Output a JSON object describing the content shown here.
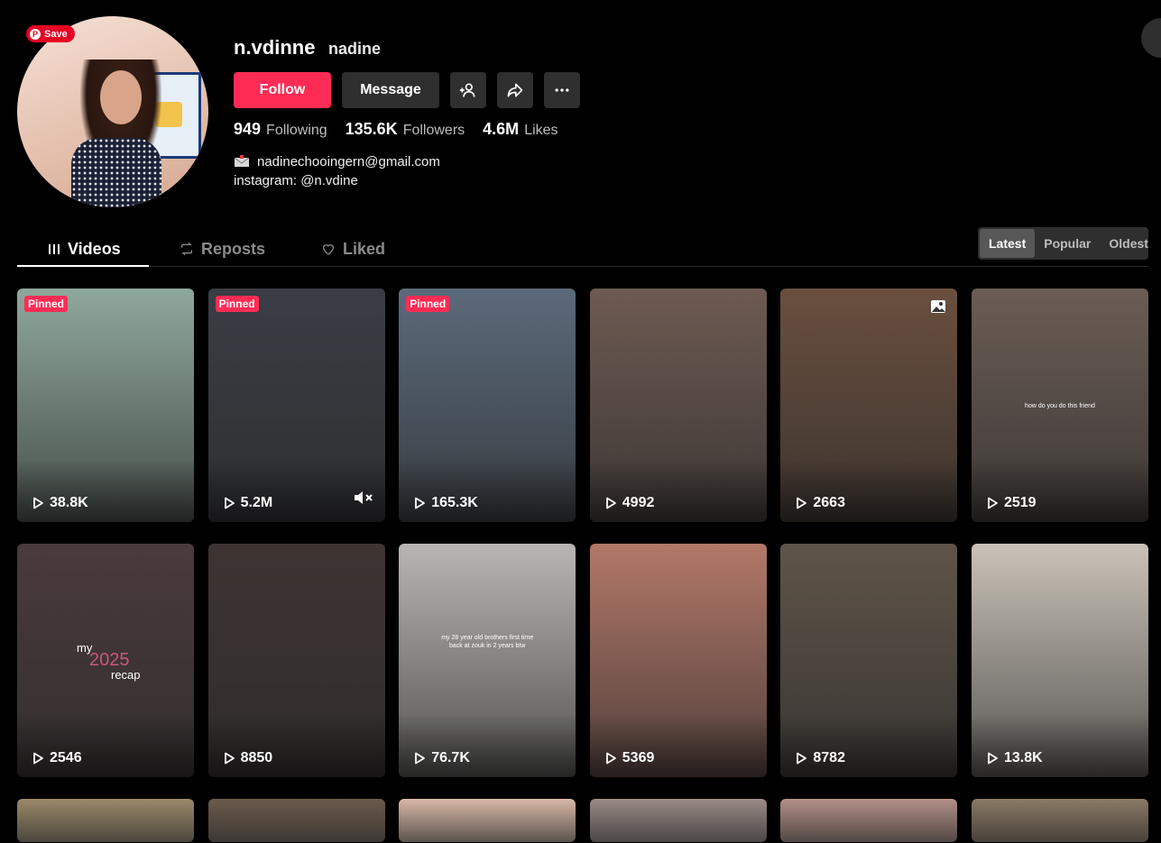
{
  "profile": {
    "save_label": "Save",
    "username": "n.vdinne",
    "nickname": "nadine",
    "follow_label": "Follow",
    "message_label": "Message",
    "stats": [
      {
        "value": "949",
        "label": "Following"
      },
      {
        "value": "135.6K",
        "label": "Followers"
      },
      {
        "value": "4.6M",
        "label": "Likes"
      }
    ],
    "bio_email": "nadinechooingern@gmail.com",
    "bio_instagram": "instagram: @n.vdine"
  },
  "tabs": [
    {
      "label": "Videos",
      "icon": "grid-lines-icon",
      "active": true
    },
    {
      "label": "Reposts",
      "icon": "repost-icon",
      "active": false
    },
    {
      "label": "Liked",
      "icon": "heart-icon",
      "active": false
    }
  ],
  "sort": [
    {
      "label": "Latest",
      "active": true
    },
    {
      "label": "Popular",
      "active": false
    },
    {
      "label": "Oldest",
      "active": false
    }
  ],
  "pinned_label": "Pinned",
  "videos": [
    {
      "views": "38.8K",
      "pinned": true,
      "bg": "#8fa89c"
    },
    {
      "views": "5.2M",
      "pinned": true,
      "muted": true,
      "bg": "#3a3d45"
    },
    {
      "views": "165.3K",
      "pinned": true,
      "bg": "#5b6a7a"
    },
    {
      "views": "4992",
      "pinned": false,
      "bg": "#6d5a52"
    },
    {
      "views": "2663",
      "pinned": false,
      "photo": true,
      "bg": "#6a4f3e"
    },
    {
      "views": "2519",
      "pinned": false,
      "bg": "#6b5d55",
      "caption": "how do you do this friend"
    },
    {
      "views": "2546",
      "pinned": false,
      "bg": "#4a3a3c",
      "recap": [
        "my",
        "2025",
        "recap"
      ]
    },
    {
      "views": "8850",
      "pinned": false,
      "bg": "#3e3432"
    },
    {
      "views": "76.7K",
      "pinned": false,
      "bg": "#b8b6b2",
      "caption": "my 28 year old brothers first time back at zouk in 2 years btw"
    },
    {
      "views": "5369",
      "pinned": false,
      "bg": "#b27868"
    },
    {
      "views": "8782",
      "pinned": false,
      "bg": "#5f5449"
    },
    {
      "views": "13.8K",
      "pinned": false,
      "bg": "#c9c2b8"
    },
    {
      "views": "",
      "pinned": false,
      "bg": "#9b8a6a"
    },
    {
      "views": "",
      "pinned": false,
      "bg": "#6b5a4c"
    },
    {
      "views": "",
      "pinned": false,
      "bg": "#d9b8a8"
    },
    {
      "views": "",
      "pinned": false,
      "bg": "#9a8b86"
    },
    {
      "views": "",
      "pinned": false,
      "bg": "#b49088"
    },
    {
      "views": "",
      "pinned": false,
      "bg": "#8c7a66"
    }
  ]
}
